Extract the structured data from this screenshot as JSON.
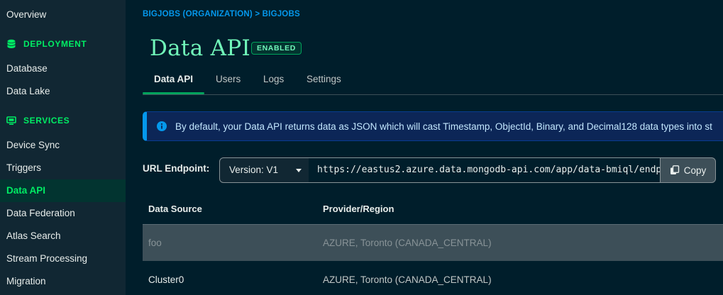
{
  "sidebar": {
    "overview": "Overview",
    "deployment_heading": "DEPLOYMENT",
    "deployment_items": [
      "Database",
      "Data Lake"
    ],
    "services_heading": "SERVICES",
    "services_items": [
      "Device Sync",
      "Triggers",
      "Data API",
      "Data Federation",
      "Atlas Search",
      "Stream Processing",
      "Migration"
    ],
    "active_item": "Data API"
  },
  "breadcrumb": "BIGJOBS (ORGANIZATION) > BIGJOBS",
  "page": {
    "title": "Data API",
    "badge": "ENABLED"
  },
  "tabs": [
    {
      "label": "Data API",
      "active": true
    },
    {
      "label": "Users",
      "active": false
    },
    {
      "label": "Logs",
      "active": false
    },
    {
      "label": "Settings",
      "active": false
    }
  ],
  "banner": {
    "text": "By default, your Data API returns data as JSON which will cast Timestamp, ObjectId, Binary, and Decimal128 data types into st"
  },
  "endpoint": {
    "label": "URL Endpoint:",
    "version": "Version: V1",
    "url": "https://eastus2.azure.data.mongodb-api.com/app/data-bmiql/endp",
    "copy_label": "Copy"
  },
  "table": {
    "headers": [
      "Data Source",
      "Provider/Region"
    ],
    "rows": [
      {
        "source": "foo",
        "region": "AZURE, Toronto (CANADA_CENTRAL)"
      },
      {
        "source": "Cluster0",
        "region": "AZURE, Toronto (CANADA_CENTRAL)"
      }
    ]
  },
  "colors": {
    "accent": "#00ed64",
    "title": "#71f6ba",
    "link": "#0498ec",
    "background": "#001e2b",
    "sidebar": "#112733"
  },
  "icons": {
    "deployment": "database-icon",
    "services": "monitor-icon",
    "banner": "info-icon",
    "copy": "copy-icon"
  }
}
